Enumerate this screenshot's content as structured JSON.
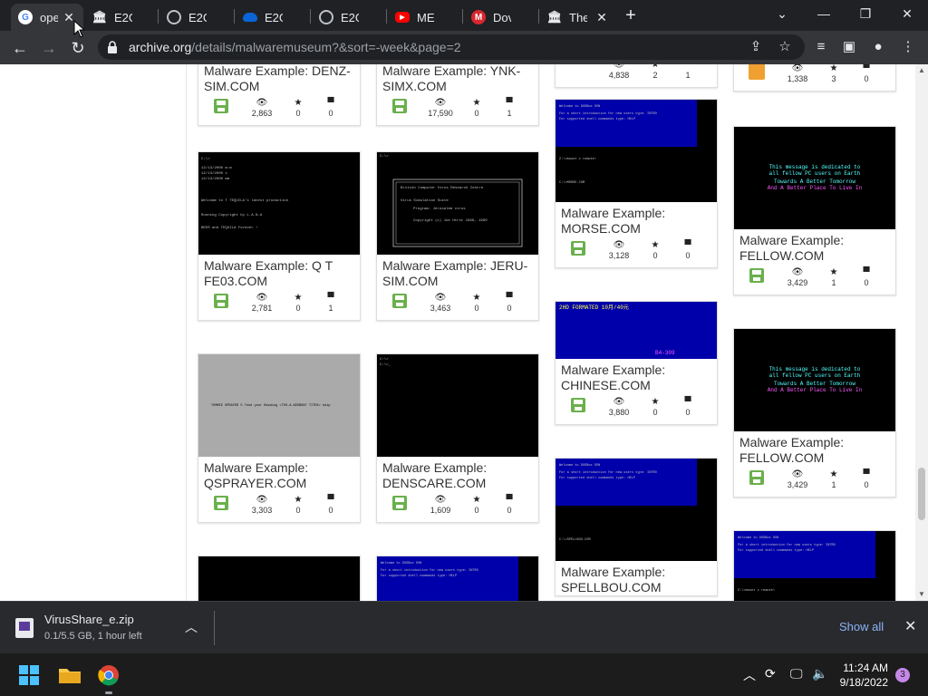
{
  "tabs": [
    {
      "label": "ope",
      "icon": "google-icon",
      "active": true
    },
    {
      "label": "E2G",
      "icon": "archive-icon"
    },
    {
      "label": "E2G",
      "icon": "globe-icon"
    },
    {
      "label": "E2G",
      "icon": "onedrive-icon"
    },
    {
      "label": "E2G",
      "icon": "globe-icon"
    },
    {
      "label": "ME",
      "icon": "youtube-icon"
    },
    {
      "label": "Dov",
      "icon": "mega-icon"
    },
    {
      "label": "The",
      "icon": "archive-icon"
    }
  ],
  "address": {
    "host": "archive.org",
    "path": "/details/malwaremuseum?&sort=-week&page=2"
  },
  "cards": [
    {
      "title": "Malware Example: DENZ-SIM.COM",
      "views": "2,863",
      "favs": "0",
      "reviews": "0"
    },
    {
      "title": "Malware Example: YNK-SIMX.COM",
      "views": "17,590",
      "favs": "0",
      "reviews": "1"
    },
    {
      "title": "",
      "views": "4,838",
      "favs": "2",
      "reviews": "1"
    },
    {
      "title": "",
      "views": "1,338",
      "favs": "3",
      "reviews": "0"
    },
    {
      "title": "Malware Example: Q T FE03.COM",
      "views": "2,781",
      "favs": "0",
      "reviews": "1"
    },
    {
      "title": "Malware Example: JERU-SIM.COM",
      "views": "3,463",
      "favs": "0",
      "reviews": "0"
    },
    {
      "title": "Malware Example: MORSE.COM",
      "views": "3,128",
      "favs": "0",
      "reviews": "0"
    },
    {
      "title": "Malware Example: FELLOW.COM",
      "views": "3,429",
      "favs": "1",
      "reviews": "0"
    },
    {
      "title": "Malware Example: QSPRAYER.COM",
      "views": "3,303",
      "favs": "0",
      "reviews": "0"
    },
    {
      "title": "Malware Example: DENSCARE.COM",
      "views": "1,609",
      "favs": "0",
      "reviews": "0"
    },
    {
      "title": "Malware Example: CHINESE.COM",
      "views": "3,880",
      "favs": "0",
      "reviews": "0"
    },
    {
      "title": "Malware Example: FELLOW.COM",
      "views": "3,429",
      "favs": "1",
      "reviews": "0"
    },
    {
      "title": "Malware Example: SPELLBOU.COM",
      "views": "",
      "favs": "",
      "reviews": ""
    }
  ],
  "screens": {
    "fellow_line1": "This message is dedicated to",
    "fellow_line2": "all fellow PC users on Earth",
    "fellow_line3": "Towards A Better Tomorrow",
    "fellow_line4": "And A Better Place To Live In",
    "chinese_top": "2HD FORMATED 10月/40元",
    "chinese_bottom": "B4-309",
    "qsprayer_text": "TOMMIE SPRAYER 5 Tend your Reading <TEH-A-KEEBRAT TITEK> bdip",
    "qt_line1": "Welcome to T TEQUILA's latest production",
    "qt_line2": "Running Copyright by L.A.N.A",
    "qt_line3": "BEER and TEQUILA forever !",
    "jeru_box1": "British Computer Virus Research Centre",
    "jeru_box2": "Virus Simulation Suite",
    "jeru_box3": "Program: Jerusalem virus",
    "jeru_box4": "Copyright (c) Joe Hirst 1989, 1990",
    "dosbox_line1": "Welcome to DOSBox SVN",
    "dosbox_line2": "For a short introduction for new users type: INTRO",
    "dosbox_line3": "For supported shell commands type: HELP"
  },
  "download": {
    "filename": "VirusShare_e.zip",
    "status": "0.1/5.5 GB, 1 hour left",
    "show_all": "Show all"
  },
  "taskbar": {
    "time": "11:24 AM",
    "date": "9/18/2022",
    "notifications": "3"
  },
  "colors": {
    "accent_link": "#8ab4f8",
    "dos_blue": "#0000aa",
    "card_icon_green": "#6ab04c"
  }
}
